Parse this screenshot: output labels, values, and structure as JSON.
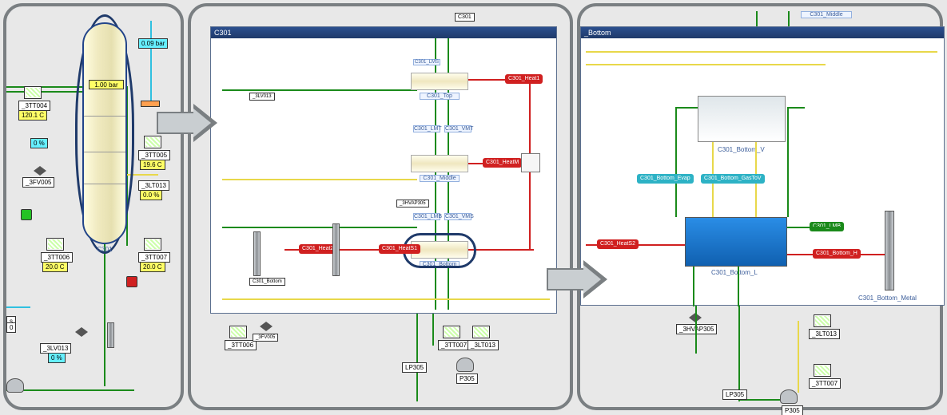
{
  "panel1": {
    "vessel_name": "C301",
    "pressure_badge": "1.00 bar",
    "top_p_reading": "0.09 bar",
    "tags": {
      "t3tt004": "_3TT004",
      "t120c": "120.1 C",
      "pct0": "0 %",
      "t3fv005": "_3FV005",
      "t3tt006": "_3TT006",
      "t20a": "20.0 C",
      "t3tt005": "_3TT005",
      "t19c": "19.6 C",
      "t3lt013": "_3LT013",
      "pct00": "0.0 %",
      "t3tt007": "_3TT007",
      "t20b": "20.0 C",
      "t3lv013": "_3LV013",
      "pct0b": "0 %",
      "sideS": "s",
      "zero": "0"
    }
  },
  "panel2": {
    "title": "C301",
    "top_label": "C301",
    "section_top_label": "C301_Top",
    "section_mid_label": "C301_Middle",
    "section_bottom_label": "C301_Bottom",
    "t3lv013b": "_3LV013",
    "t3tt006b": "_3TT006",
    "t3tt007b": "_3TT007",
    "t3lt013b": "_3LT013",
    "t3fv005b": "_3FV005",
    "blk_heat1": "C301_Heat1",
    "blk_heat2": "C301_Heat2",
    "blk_heatM": "C301_HeatM",
    "blk_heatS1": "C301_HeatS1",
    "lmb": "C301_LMB",
    "lmt": "C301_LMT",
    "vmt": "C301_VMT",
    "lms": "C301_LMS",
    "vms": "C301_VMS",
    "shvap305": "_3HVAP305",
    "lp305": "LP305",
    "p305": "P305"
  },
  "panel3": {
    "title": "_Bottom",
    "middle_label": "C301_Middle",
    "cloud_label": "C301_Bottom_V",
    "water_label": "C301_Bottom_L",
    "metal_label": "C301_Bottom_Metal",
    "evap": "C301_Bottom_Evap",
    "gastov": "C301_Bottom_GasToV",
    "heats2": "C301_HeatS2",
    "bottomh": "C301_Bottom_H",
    "lmb": "C301_LMB",
    "shvap305": "_3HVAP305",
    "t3lt013": "_3LT013",
    "t3tt007": "_3TT007",
    "lp305": "LP305",
    "p305": "P305"
  }
}
